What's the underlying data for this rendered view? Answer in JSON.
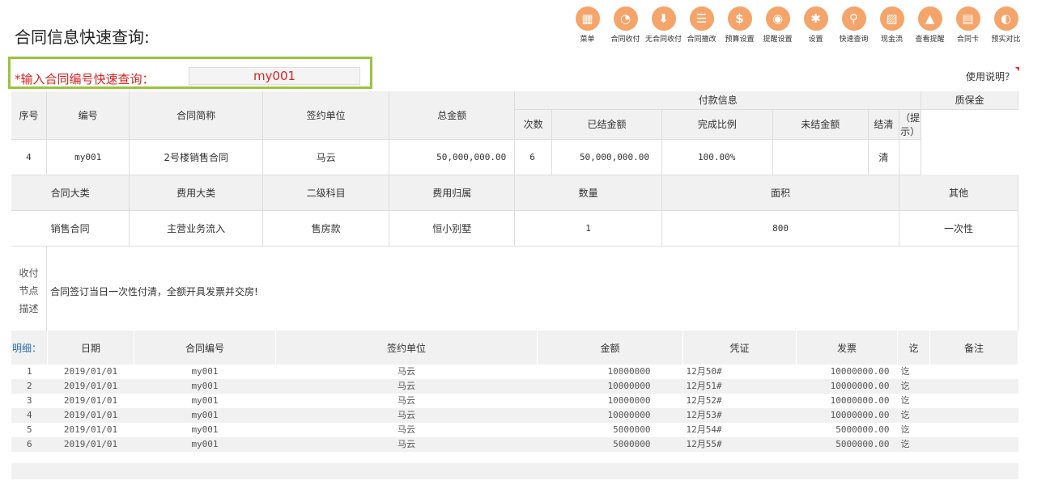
{
  "page": {
    "title": "合同信息快速查询:"
  },
  "toolbar": [
    {
      "label": "菜单",
      "icon": "menu-grid-icon",
      "glyph": "▦"
    },
    {
      "label": "合同收付",
      "icon": "wallet-icon",
      "glyph": "◔"
    },
    {
      "label": "无合同收付",
      "icon": "download-icon",
      "glyph": "⬇"
    },
    {
      "label": "合同擅改",
      "icon": "document-icon",
      "glyph": "☰"
    },
    {
      "label": "预算设置",
      "icon": "money-bag-icon",
      "glyph": "$"
    },
    {
      "label": "提醒设置",
      "icon": "sound-icon",
      "glyph": "◉"
    },
    {
      "label": "设置",
      "icon": "gear-icon",
      "glyph": "✱"
    },
    {
      "label": "快速查询",
      "icon": "search-icon",
      "glyph": "⚲"
    },
    {
      "label": "现金流",
      "icon": "chart-icon",
      "glyph": "▨"
    },
    {
      "label": "查看提醒",
      "icon": "bell-icon",
      "glyph": "▲"
    },
    {
      "label": "合同卡",
      "icon": "card-icon",
      "glyph": "▤"
    },
    {
      "label": "预实对比",
      "icon": "compare-icon",
      "glyph": "◐"
    }
  ],
  "query": {
    "label": "*输入合同编号快速查询：",
    "value": "my001"
  },
  "help": "使用说明？",
  "main": {
    "headers": {
      "seq": "序号",
      "code": "编号",
      "name": "合同简称",
      "party": "签约单位",
      "total": "总金额",
      "payinfo": "付款信息",
      "deposit": "质保金",
      "count": "次数",
      "paid": "已结金额",
      "ratio": "完成比例",
      "unpaid": "未结金额",
      "settled": "结清",
      "hint": "（提示）"
    },
    "row": {
      "seq": "4",
      "code": "my001",
      "name": "2号楼销售合同",
      "party": "马云",
      "total": "50,000,000.00",
      "count": "6",
      "paid": "50,000,000.00",
      "ratio": "100.00%",
      "unpaid": "",
      "settled": "清",
      "deposit": ""
    },
    "headers2": {
      "category": "合同大类",
      "fee": "费用大类",
      "sub": "二级科目",
      "belong": "费用归属",
      "qty": "数量",
      "area": "面积",
      "other": "其他"
    },
    "row2": {
      "category": "销售合同",
      "fee": "主营业务流入",
      "sub": "售房款",
      "belong": "恒小别墅",
      "qty": "1",
      "area": "800",
      "other": "一次性"
    },
    "node": {
      "label": "收付节点描述",
      "text": "合同签订当日一次性付清，全额开具发票并交房!"
    }
  },
  "detail": {
    "headers": {
      "label": "明细：",
      "date": "日期",
      "code": "合同编号",
      "party": "签约单位",
      "amount": "金额",
      "voucher": "凭证",
      "invoice": "发票",
      "done": "讫",
      "note": "备注"
    },
    "rows": [
      {
        "no": "1",
        "date": "2019/01/01",
        "code": "my001",
        "party": "马云",
        "amount": "10000000",
        "voucher": "12月50#",
        "invoice": "10000000.00",
        "done": "讫",
        "note": ""
      },
      {
        "no": "2",
        "date": "2019/01/01",
        "code": "my001",
        "party": "马云",
        "amount": "10000000",
        "voucher": "12月51#",
        "invoice": "10000000.00",
        "done": "讫",
        "note": ""
      },
      {
        "no": "3",
        "date": "2019/01/01",
        "code": "my001",
        "party": "马云",
        "amount": "10000000",
        "voucher": "12月52#",
        "invoice": "10000000.00",
        "done": "讫",
        "note": ""
      },
      {
        "no": "4",
        "date": "2019/01/01",
        "code": "my001",
        "party": "马云",
        "amount": "10000000",
        "voucher": "12月53#",
        "invoice": "10000000.00",
        "done": "讫",
        "note": ""
      },
      {
        "no": "5",
        "date": "2019/01/01",
        "code": "my001",
        "party": "马云",
        "amount": "5000000",
        "voucher": "12月54#",
        "invoice": "5000000.00",
        "done": "讫",
        "note": ""
      },
      {
        "no": "6",
        "date": "2019/01/01",
        "code": "my001",
        "party": "马云",
        "amount": "5000000",
        "voucher": "12月55#",
        "invoice": "5000000.00",
        "done": "讫",
        "note": ""
      }
    ]
  }
}
